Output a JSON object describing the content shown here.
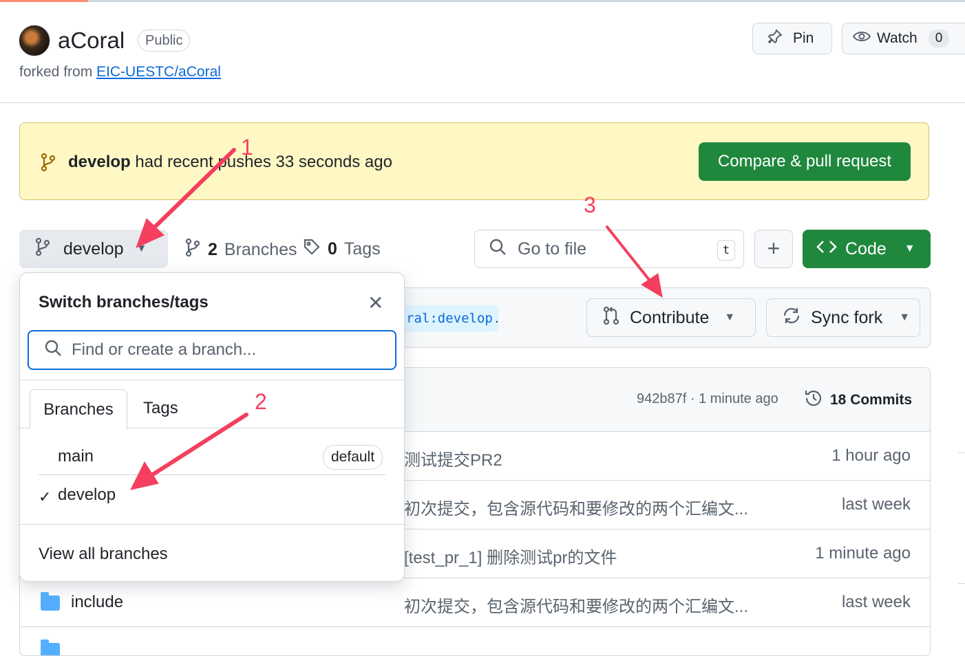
{
  "repo": {
    "name": "aCoral",
    "visibility": "Public",
    "forked_prefix": "forked from ",
    "forked_from": "EIC-UESTC/aCoral"
  },
  "header_actions": {
    "pin_label": "Pin",
    "watch_label": "Watch",
    "watch_count": "0"
  },
  "banner": {
    "branch": "develop",
    "text": " had recent pushes 33 seconds ago",
    "button": "Compare & pull request"
  },
  "toolbar": {
    "current_branch": "develop",
    "branches_count": "2",
    "branches_label": "Branches",
    "tags_count": "0",
    "tags_label": "Tags",
    "goto_placeholder": "Go to file",
    "goto_shortcut": "t",
    "add_label": "+",
    "code_label": "Code"
  },
  "sync_bar": {
    "ref_chip": "ral:develop",
    "trailing": ".",
    "contribute_label": "Contribute",
    "sync_label": "Sync fork"
  },
  "latest_commit": {
    "meta": "942b87f · 1 minute ago",
    "commits_label": "18 Commits"
  },
  "file_rows": [
    {
      "name": "",
      "message": "测试提交PR2",
      "time": "1 hour ago"
    },
    {
      "name": "",
      "message": "初次提交，包含源代码和要修改的两个汇编文...",
      "time": "last week"
    },
    {
      "name": "",
      "message": "[test_pr_1] 删除测试pr的文件",
      "time": "1 minute ago"
    },
    {
      "name": "include",
      "message": "初次提交，包含源代码和要修改的两个汇编文...",
      "time": "last week"
    }
  ],
  "branch_dropdown": {
    "title": "Switch branches/tags",
    "search_placeholder": "Find or create a branch...",
    "tab_branches": "Branches",
    "tab_tags": "Tags",
    "branches": [
      {
        "name": "main",
        "badge": "default",
        "selected": false
      },
      {
        "name": "develop",
        "badge": "",
        "selected": true
      }
    ],
    "check_mark": "✓",
    "view_all": "View all branches"
  },
  "annotations": [
    "1",
    "2",
    "3"
  ],
  "colors": {
    "primary_green": "#1f883d",
    "link_blue": "#0969da",
    "banner_bg": "#fff8c5",
    "annotation_red": "#f43f5e"
  }
}
